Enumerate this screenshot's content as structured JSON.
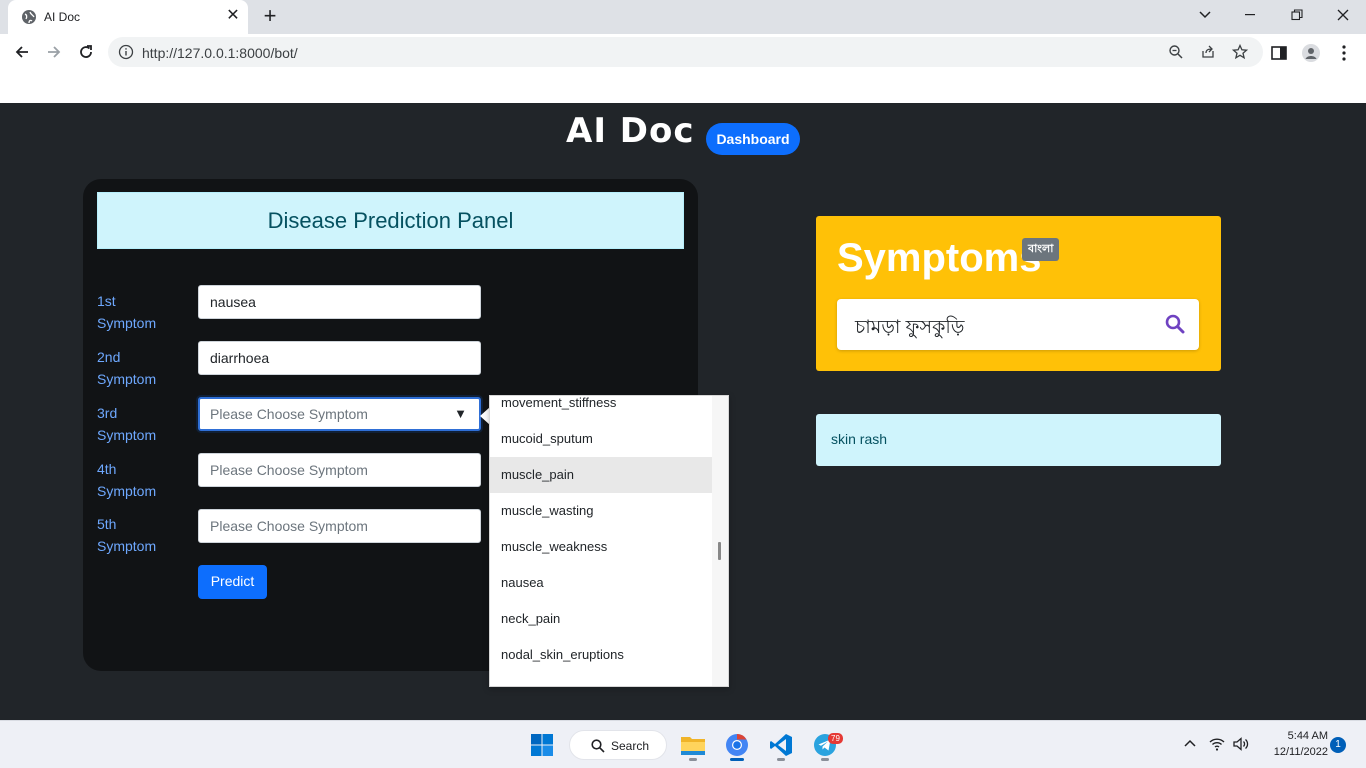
{
  "browser": {
    "tab_title": "AI Doc",
    "url": "http://127.0.0.1:8000/bot/"
  },
  "header": {
    "brand": "AI Doc",
    "dashboard_label": "Dashboard"
  },
  "panel": {
    "title": "Disease Prediction Panel",
    "symptoms": [
      {
        "label_line1": "1st",
        "label_line2": "Symptom",
        "value": "nausea",
        "placeholder": ""
      },
      {
        "label_line1": "2nd",
        "label_line2": "Symptom",
        "value": "diarrhoea",
        "placeholder": ""
      },
      {
        "label_line1": "3rd",
        "label_line2": "Symptom",
        "value": "",
        "placeholder": "Please Choose Symptom"
      },
      {
        "label_line1": "4th",
        "label_line2": "Symptom",
        "value": "",
        "placeholder": "Please Choose Symptom"
      },
      {
        "label_line1": "5th",
        "label_line2": "Symptom",
        "value": "",
        "placeholder": "Please Choose Symptom"
      }
    ],
    "predict_label": "Predict"
  },
  "dropdown": {
    "caret": "▼",
    "options": [
      "movement_stiffness",
      "mucoid_sputum",
      "muscle_pain",
      "muscle_wasting",
      "muscle_weakness",
      "nausea",
      "neck_pain",
      "nodal_skin_eruptions"
    ],
    "highlighted": "muscle_pain"
  },
  "symptoms_card": {
    "title": "Symptoms",
    "lang_badge": "বাংলা",
    "search_value": "চামড়া ফুসকুড়ি",
    "search_icon": "search-icon"
  },
  "result": {
    "text": "skin rash"
  },
  "taskbar": {
    "search_label": "Search",
    "telegram_badge": "79",
    "time": "5:44 AM",
    "date": "12/11/2022",
    "notification_count": "1"
  },
  "colors": {
    "page_bg": "#212529",
    "panel_bg": "#111315",
    "accent_blue": "#0d6efd",
    "warning_yellow": "#ffc107",
    "info_light": "#cff4fc"
  }
}
